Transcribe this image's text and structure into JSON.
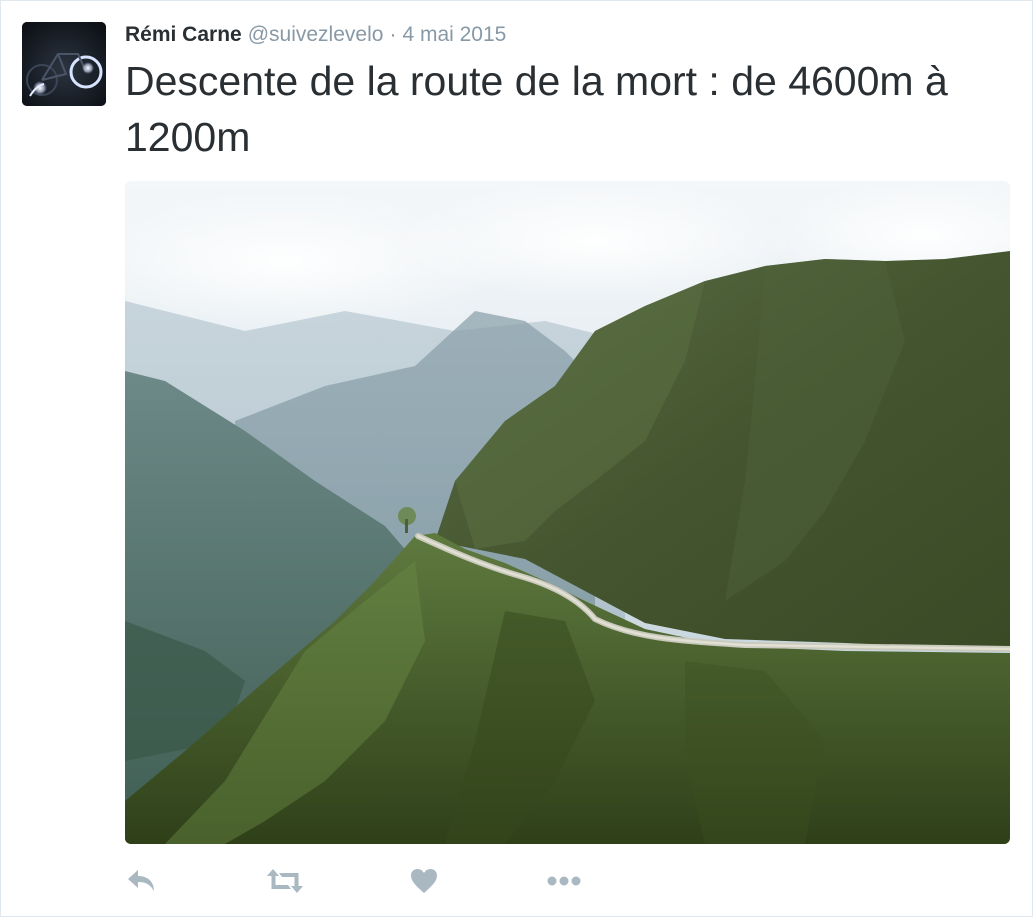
{
  "tweet": {
    "author": {
      "name": "Rémi Carne",
      "handle": "@suivezlevelo",
      "avatar": "cyclist-night-photo"
    },
    "separator": "·",
    "date": "4 mai 2015",
    "text": "Descente de la route de la mort : de 4600m à 1200m",
    "media": {
      "description": "mountain-road-photo"
    },
    "actions": [
      {
        "name": "reply",
        "icon": "reply-icon"
      },
      {
        "name": "retweet",
        "icon": "retweet-icon"
      },
      {
        "name": "like",
        "icon": "heart-icon"
      },
      {
        "name": "more",
        "icon": "more-dots-icon"
      }
    ]
  },
  "colors": {
    "text": "#292f33",
    "secondary": "#8899a6",
    "action_icon": "#aab8c2",
    "border": "#e1e8ed"
  }
}
